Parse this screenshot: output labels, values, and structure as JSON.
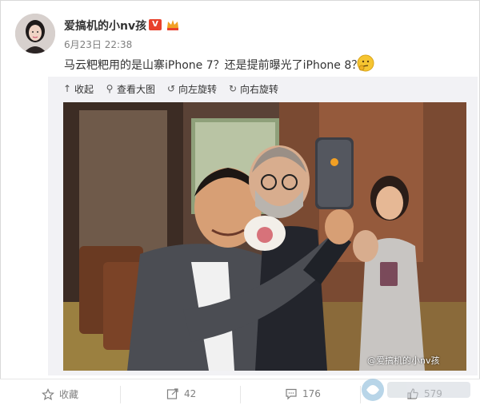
{
  "post": {
    "username": "爱搞机的小nv孩",
    "vip_badge": "V",
    "timestamp": "6月23日 22:38",
    "text": "马云粑粑用的是山寨iPhone 7？还是提前曝光了iPhone 8？"
  },
  "toolbar": {
    "collapse": "收起",
    "view_large": "查看大图",
    "rotate_left": "向左旋转",
    "rotate_right": "向右旋转"
  },
  "photo": {
    "watermark": "@爱搞机的小nv孩"
  },
  "actions": {
    "favorite": "收藏",
    "repost_count": "42",
    "comment_count": "176",
    "like_count": "579"
  },
  "colors": {
    "vip": "#e8412c",
    "text": "#333333",
    "muted": "#808080",
    "panel": "#f2f2f5"
  }
}
